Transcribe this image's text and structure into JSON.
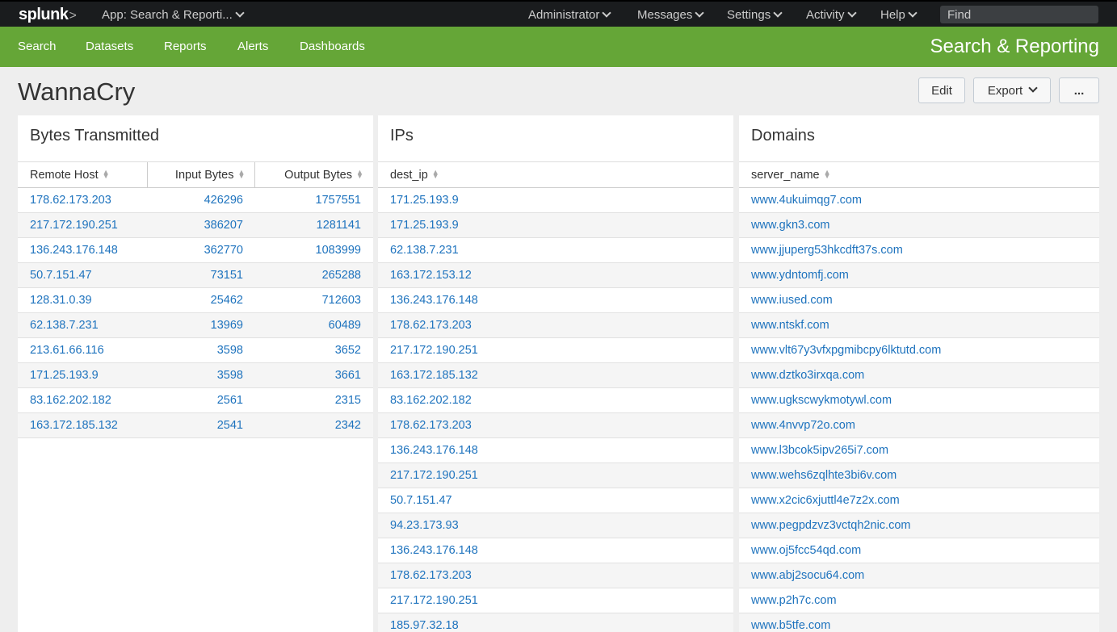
{
  "topbar": {
    "logo": "splunk",
    "logo_chevron": ">",
    "app_menu": "App: Search & Reporti...",
    "menus": [
      "Administrator",
      "Messages",
      "Settings",
      "Activity",
      "Help"
    ],
    "find_placeholder": "Find"
  },
  "nav": {
    "items": [
      "Search",
      "Datasets",
      "Reports",
      "Alerts",
      "Dashboards"
    ],
    "app_title": "Search & Reporting"
  },
  "header": {
    "title": "WannaCry",
    "edit_label": "Edit",
    "export_label": "Export",
    "more_label": "..."
  },
  "panels": {
    "bytes": {
      "title": "Bytes Transmitted",
      "columns": [
        "Remote Host",
        "Input Bytes",
        "Output Bytes"
      ],
      "rows": [
        [
          "178.62.173.203",
          "426296",
          "1757551"
        ],
        [
          "217.172.190.251",
          "386207",
          "1281141"
        ],
        [
          "136.243.176.148",
          "362770",
          "1083999"
        ],
        [
          "50.7.151.47",
          "73151",
          "265288"
        ],
        [
          "128.31.0.39",
          "25462",
          "712603"
        ],
        [
          "62.138.7.231",
          "13969",
          "60489"
        ],
        [
          "213.61.66.116",
          "3598",
          "3652"
        ],
        [
          "171.25.193.9",
          "3598",
          "3661"
        ],
        [
          "83.162.202.182",
          "2561",
          "2315"
        ],
        [
          "163.172.185.132",
          "2541",
          "2342"
        ]
      ]
    },
    "ips": {
      "title": "IPs",
      "columns": [
        "dest_ip"
      ],
      "rows": [
        "171.25.193.9",
        "171.25.193.9",
        "62.138.7.231",
        "163.172.153.12",
        "136.243.176.148",
        "178.62.173.203",
        "217.172.190.251",
        "163.172.185.132",
        "83.162.202.182",
        "178.62.173.203",
        "136.243.176.148",
        "217.172.190.251",
        "50.7.151.47",
        "94.23.173.93",
        "136.243.176.148",
        "178.62.173.203",
        "217.172.190.251",
        "185.97.32.18"
      ]
    },
    "domains": {
      "title": "Domains",
      "columns": [
        "server_name"
      ],
      "rows": [
        "www.4ukuimqg7.com",
        "www.gkn3.com",
        "www.jjuperg53hkcdft37s.com",
        "www.ydntomfj.com",
        "www.iused.com",
        "www.ntskf.com",
        "www.vlt67y3vfxpgmibcpy6lktutd.com",
        "www.dztko3irxqa.com",
        "www.ugkscwykmotywl.com",
        "www.4nvvp72o.com",
        "www.l3bcok5ipv265i7.com",
        "www.wehs6zqlhte3bi6v.com",
        "www.x2cic6xjuttl4e7z2x.com",
        "www.pegpdzvz3vctqh2nic.com",
        "www.oj5fcc54qd.com",
        "www.abj2socu64.com",
        "www.p2h7c.com",
        "www.b5tfe.com"
      ]
    }
  }
}
